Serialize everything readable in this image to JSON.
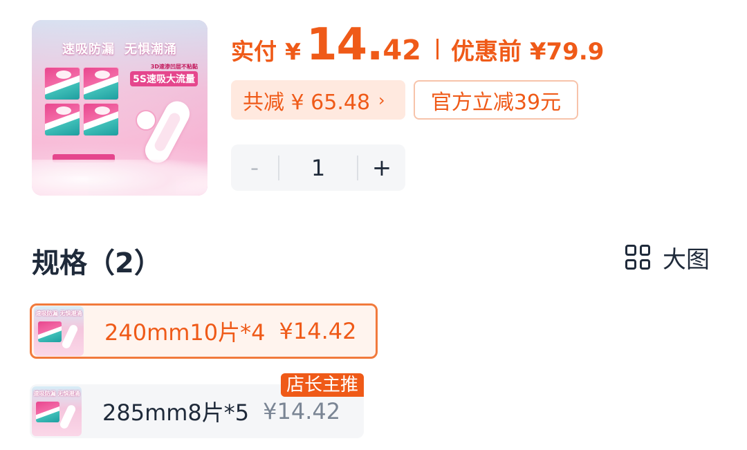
{
  "product": {
    "thumb_headline": [
      "速吸防漏",
      "无惧潮涌"
    ],
    "thumb_sub1": "3D速渗凹层不粘黏",
    "thumb_sub2": "5S速吸大流量",
    "thumb_icon": "product-image"
  },
  "price": {
    "paid_label": "实付",
    "currency": "¥",
    "paid_int": "14.",
    "paid_dec": "42",
    "original_label": "优惠前 ¥79.9"
  },
  "discount": {
    "total_label": "共减 ¥ 65.48",
    "total_chevron": "›",
    "official_label": "官方立减39元"
  },
  "quantity": {
    "minus": "-",
    "value": "1",
    "plus": "+"
  },
  "spec": {
    "title": "规格（2）",
    "big_view_label": "大图",
    "options": [
      {
        "label": "240mm10片*4",
        "price": "¥14.42",
        "selected": true,
        "mini_text": "速吸防漏 无惧潮涌"
      },
      {
        "label": "285mm8片*5",
        "price": "¥14.42",
        "selected": false,
        "badge": "店长主推",
        "mini_text": "速吸防漏 无惧潮涌"
      }
    ]
  },
  "colors": {
    "accent": "#ef5a18",
    "accent_bg": "#ffe9df",
    "text": "#1f2a3a",
    "muted": "#7a8594"
  }
}
